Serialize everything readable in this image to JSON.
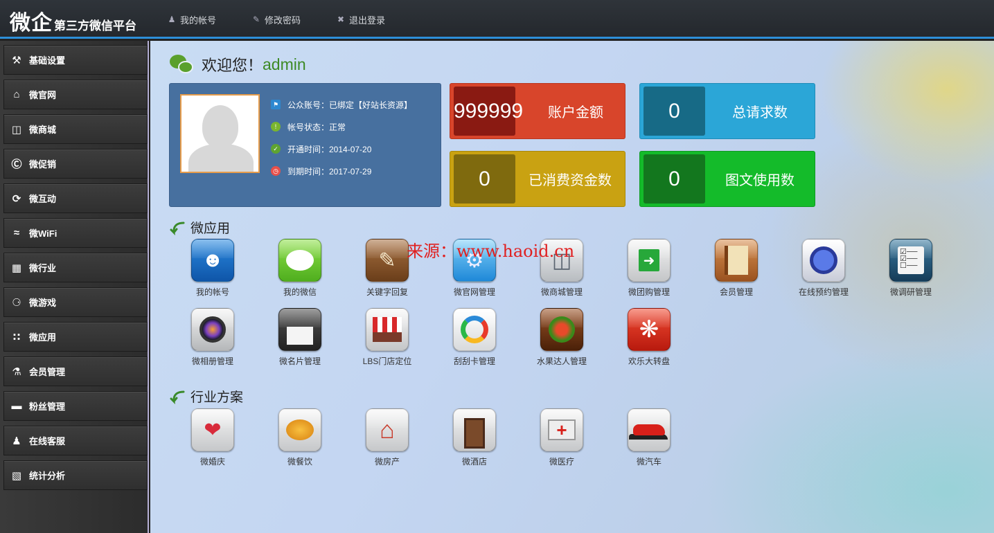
{
  "header": {
    "logo_big": "微企",
    "logo_small": "第三方微信平台",
    "nav": [
      {
        "label": "我的帐号",
        "icon": "user-icon"
      },
      {
        "label": "修改密码",
        "icon": "edit-icon"
      },
      {
        "label": "退出登录",
        "icon": "logout-icon"
      }
    ]
  },
  "sidebar": {
    "items": [
      {
        "label": "基础设置",
        "icon": "wrench-icon"
      },
      {
        "label": "微官网",
        "icon": "home-icon"
      },
      {
        "label": "微商城",
        "icon": "cart-icon"
      },
      {
        "label": "微促销",
        "icon": "skype-icon"
      },
      {
        "label": "微互动",
        "icon": "refresh-icon"
      },
      {
        "label": "微WiFi",
        "icon": "wifi-icon"
      },
      {
        "label": "微行业",
        "icon": "grid-icon"
      },
      {
        "label": "微游戏",
        "icon": "gamepad-icon"
      },
      {
        "label": "微应用",
        "icon": "apps-icon"
      },
      {
        "label": "会员管理",
        "icon": "flask-icon"
      },
      {
        "label": "粉丝管理",
        "icon": "card-icon"
      },
      {
        "label": "在线客服",
        "icon": "users-icon"
      },
      {
        "label": "统计分析",
        "icon": "chart-icon"
      }
    ]
  },
  "welcome": {
    "text": "欢迎您！",
    "username": "admin"
  },
  "profile": {
    "rows": [
      {
        "text": "公众账号：已绑定【好站长资源】",
        "icon": "flag-icon",
        "color": "#2d88d0"
      },
      {
        "text": "帐号状态：正常",
        "icon": "info-icon",
        "color": "#7ab52e"
      },
      {
        "text": "开通时间：2014-07-20",
        "icon": "check-icon",
        "color": "#5fa431"
      },
      {
        "text": "到期时间：2017-07-29",
        "icon": "clock-icon",
        "color": "#e8504a"
      }
    ]
  },
  "stats": [
    {
      "value": "999999",
      "label": "账户金额",
      "bg": "#d8452b",
      "num_bg": "#8a1a12"
    },
    {
      "value": "0",
      "label": "总请求数",
      "bg": "#2ba6d7",
      "num_bg": "#176a86"
    },
    {
      "value": "0",
      "label": "已消费资金数",
      "bg": "#c9a212",
      "num_bg": "#7f6a0e"
    },
    {
      "value": "0",
      "label": "图文使用数",
      "bg": "#14bb2a",
      "num_bg": "#13771e"
    }
  ],
  "sections": {
    "apps_title": "微应用",
    "industry_title": "行业方案"
  },
  "apps": [
    {
      "label": "我的帐号",
      "icon": "mother-baby-icon",
      "color": "#1a6fc4"
    },
    {
      "label": "我的微信",
      "icon": "chat-bubble-icon",
      "color": "#6dcc32"
    },
    {
      "label": "关键字回复",
      "icon": "contacts-book-icon",
      "color": "#8a5a2b"
    },
    {
      "label": "微官网管理",
      "icon": "wrench-gear-icon",
      "color": "#3aa8e8"
    },
    {
      "label": "微商城管理",
      "icon": "shopping-cart-icon",
      "color": "#c8ccd0"
    },
    {
      "label": "微团购管理",
      "icon": "exit-door-icon",
      "color": "#d8dadc"
    },
    {
      "label": "会员管理",
      "icon": "notebook-icon",
      "color": "#b86a30"
    },
    {
      "label": "在线预约管理",
      "icon": "headphones-icon",
      "color": "#e8ecf4"
    },
    {
      "label": "微调研管理",
      "icon": "checklist-icon",
      "color": "#2a5a7a"
    },
    {
      "label": "微相册管理",
      "icon": "camera-lens-icon",
      "color": "#d0d2d4"
    },
    {
      "label": "微名片管理",
      "icon": "floppy-disk-icon",
      "color": "#3a3a3a"
    },
    {
      "label": "LBS门店定位",
      "icon": "storefront-icon",
      "color": "#e0e2e4"
    },
    {
      "label": "刮刮卡管理",
      "icon": "swirl-logo-icon",
      "color": "#f0f2f4"
    },
    {
      "label": "水果达人管理",
      "icon": "fruit-ninja-icon",
      "color": "#7a3a18"
    },
    {
      "label": "欢乐大转盘",
      "icon": "yelp-icon",
      "color": "#d42a1a"
    }
  ],
  "industry": [
    {
      "label": "微婚庆",
      "icon": "wedding-heart-icon",
      "color": "#e4e6e8"
    },
    {
      "label": "微餐饮",
      "icon": "food-basket-icon",
      "color": "#e4e6e8"
    },
    {
      "label": "微房产",
      "icon": "house-icon",
      "color": "#e4e6e8"
    },
    {
      "label": "微酒店",
      "icon": "hotel-door-icon",
      "color": "#e4e6e8"
    },
    {
      "label": "微医疗",
      "icon": "first-aid-kit-icon",
      "color": "#e4e6e8"
    },
    {
      "label": "微汽车",
      "icon": "red-car-icon",
      "color": "#e4e6e8"
    }
  ],
  "watermark": "来源：www.haoid.cn"
}
